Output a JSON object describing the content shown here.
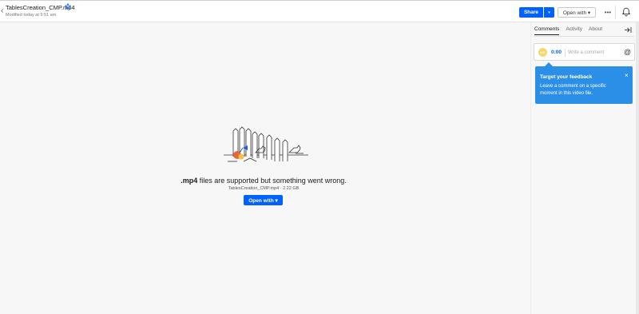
{
  "header": {
    "back_icon": "chevron-left-icon",
    "filename": "TablesCreation_CMP.mp4",
    "modified": "Modified today at 9:51 am",
    "star_icon": "star-icon"
  },
  "toolbar": {
    "share_label": "Share",
    "share_dropdown": "▾",
    "open_with_label": "Open with ▾",
    "more_label": "•••",
    "bell_icon": "bell-icon"
  },
  "sidebar": {
    "tabs": [
      {
        "label": "Comments",
        "active": true
      },
      {
        "label": "Activity",
        "active": false
      },
      {
        "label": "About",
        "active": false
      }
    ],
    "collapse_icon": "arrow-right-bar-icon",
    "comment": {
      "avatar_initials": "MB",
      "timestamp": "0:00",
      "placeholder": "Write a comment",
      "mention_icon": "@"
    },
    "tooltip": {
      "title": "Target your feedback",
      "text": "Leave a comment on a specific moment in this video file.",
      "close": "×"
    }
  },
  "main": {
    "error_ext": ".mp4",
    "error_text": " files are supported but something went wrong.",
    "file_info": "TablesCreation_CMP.mp4 · 2.22 GB",
    "open_with_label": "Open with ▾"
  },
  "colors": {
    "accent": "#0061fe",
    "tooltip": "#2b8fe8",
    "background": "#f7f7f8"
  }
}
